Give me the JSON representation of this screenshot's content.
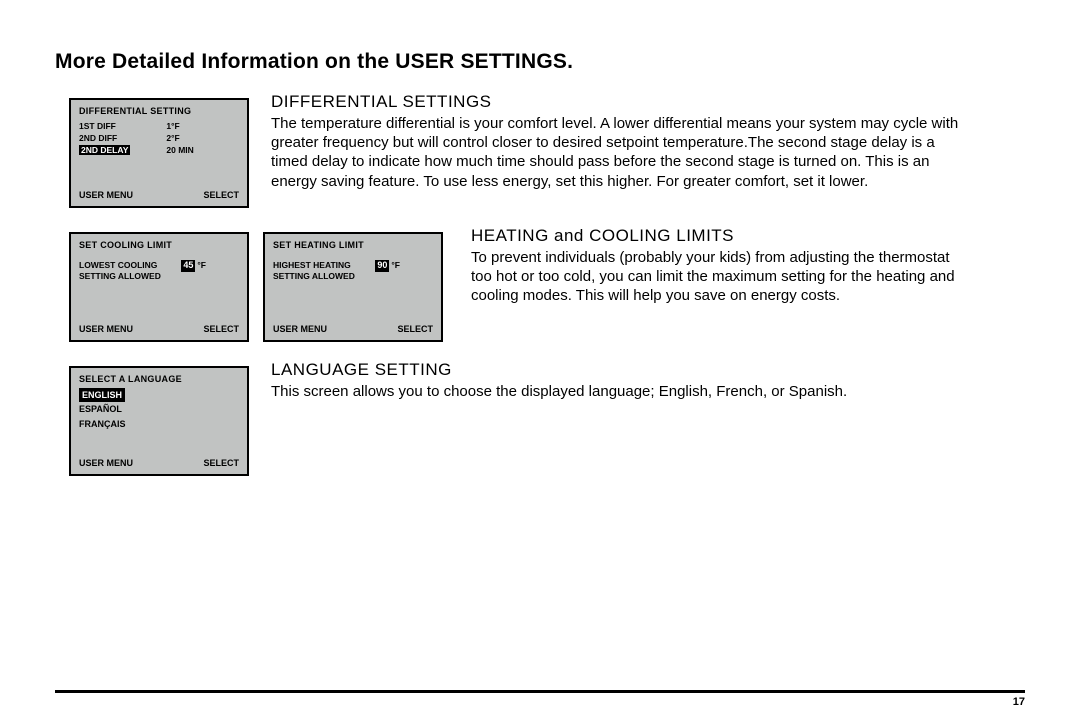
{
  "title": "More Detailed Information on the USER SETTINGS.",
  "page_number": "17",
  "sections": {
    "diff": {
      "heading": "DIFFERENTIAL SETTINGS",
      "body": "The temperature differential is your comfort level. A lower differential means your system may cycle with greater frequency but will control closer to desired setpoint temperature.The second stage delay is a timed delay to indicate how much time should pass before the second stage is turned on. This is an energy saving feature. To use less energy, set this higher. For greater comfort, set it lower."
    },
    "limits": {
      "heading": "HEATING and COOLING LIMITS",
      "body": "To prevent individuals (probably your kids) from adjusting the thermostat too hot or too cold, you can limit the maximum setting for the heating and cooling modes. This will help you save on energy costs."
    },
    "lang": {
      "heading": "LANGUAGE SETTING",
      "body": "This screen allows you to choose the displayed language; English, French, or Spanish."
    }
  },
  "lcd": {
    "diff": {
      "title": "DIFFERENTIAL SETTING",
      "rows": [
        {
          "label": "1ST DIFF",
          "value": "1°F"
        },
        {
          "label": "2ND DIFF",
          "value": "2°F"
        }
      ],
      "highlight_row": {
        "label": "2ND DELAY",
        "value": "20 MIN"
      },
      "footer_left": "USER MENU",
      "footer_right": "SELECT"
    },
    "cool": {
      "title": "SET COOLING LIMIT",
      "label1": "LOWEST COOLING",
      "label2": "SETTING ALLOWED",
      "value_chip": "45",
      "value_unit": "°F",
      "footer_left": "USER MENU",
      "footer_right": "SELECT"
    },
    "heat": {
      "title": "SET HEATING LIMIT",
      "label1": "HIGHEST HEATING",
      "label2": "SETTING ALLOWED",
      "value_chip": "90",
      "value_unit": "°F",
      "footer_left": "USER MENU",
      "footer_right": "SELECT"
    },
    "lang": {
      "title": "SELECT A LANGUAGE",
      "options": {
        "selected": "ENGLISH",
        "opt2": "ESPAÑOL",
        "opt3": "FRANÇAIS"
      },
      "footer_left": "USER MENU",
      "footer_right": "SELECT"
    }
  }
}
